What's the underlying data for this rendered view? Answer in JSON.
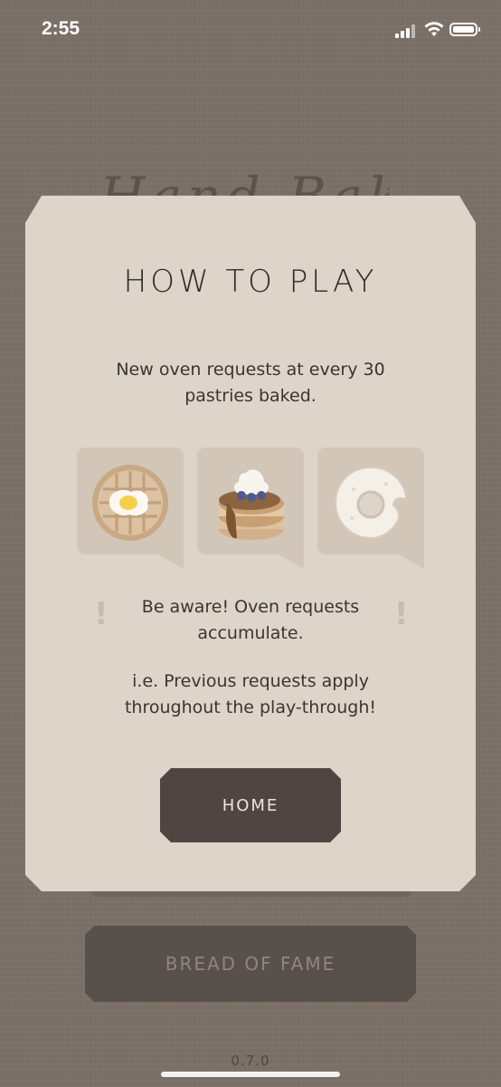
{
  "status": {
    "time": "2:55"
  },
  "background": {
    "title": "Hand Bake",
    "fame_label": "BREAD OF FAME",
    "version": "0.7.0"
  },
  "modal": {
    "title": "HOW TO PLAY",
    "description": "New oven requests at every 30 pastries baked.",
    "cards": [
      {
        "icon": "waffle-egg-icon"
      },
      {
        "icon": "pancake-stack-icon"
      },
      {
        "icon": "bitten-donut-icon"
      }
    ],
    "aware_text": "Be aware!  Oven requests accumulate.",
    "ie_text": "i.e. Previous requests apply throughout the play-through!",
    "home_label": "HOME"
  },
  "colors": {
    "background": "#7b7067",
    "modal": "#ddd4ca",
    "button_dark": "#4f4641",
    "text_dark": "#2f2a27"
  }
}
